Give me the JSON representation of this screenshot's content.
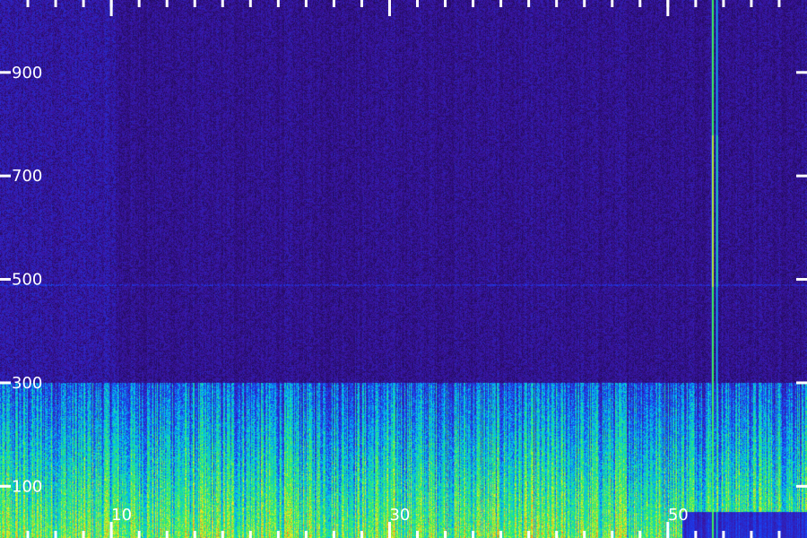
{
  "chart_data": {
    "type": "heatmap",
    "title": "",
    "xlabel": "",
    "ylabel": "",
    "x_tick_labels": [
      "10",
      "30",
      "50"
    ],
    "x_tick_values": [
      10,
      30,
      50
    ],
    "xlim": [
      2,
      60
    ],
    "y_tick_labels": [
      "100",
      "300",
      "500",
      "700",
      "900"
    ],
    "y_tick_values": [
      100,
      300,
      500,
      700,
      900
    ],
    "ylim": [
      0,
      1040
    ],
    "minor_x_ticks": [
      4,
      6,
      8,
      10,
      12,
      14,
      16,
      18,
      20,
      22,
      24,
      26,
      28,
      30,
      32,
      34,
      36,
      38,
      40,
      42,
      44,
      46,
      48,
      50,
      52,
      54,
      56,
      58
    ],
    "colormap": [
      "#1a0840",
      "#3a14a0",
      "#1a3cf0",
      "#00c8f0",
      "#30f060",
      "#f0f020",
      "#ff4020"
    ],
    "grid": false,
    "features": [
      {
        "kind": "high-energy band",
        "y_from": 0,
        "y_to": 300,
        "x_from": 2,
        "x_to": 60,
        "level": 0.7
      },
      {
        "kind": "vertical streak",
        "x": 53.2,
        "y_from": 0,
        "y_to": 1040,
        "level": 0.9
      },
      {
        "kind": "vertical streak",
        "x": 53.5,
        "y_from": 0,
        "y_to": 1040,
        "level": 0.6
      },
      {
        "kind": "horizontal line",
        "y": 490,
        "x_from": 2,
        "x_to": 60,
        "level": 0.25
      },
      {
        "kind": "brighter region",
        "x_from": 2,
        "x_to": 10.3,
        "y_from": 300,
        "y_to": 1040,
        "level": 0.3
      }
    ]
  }
}
